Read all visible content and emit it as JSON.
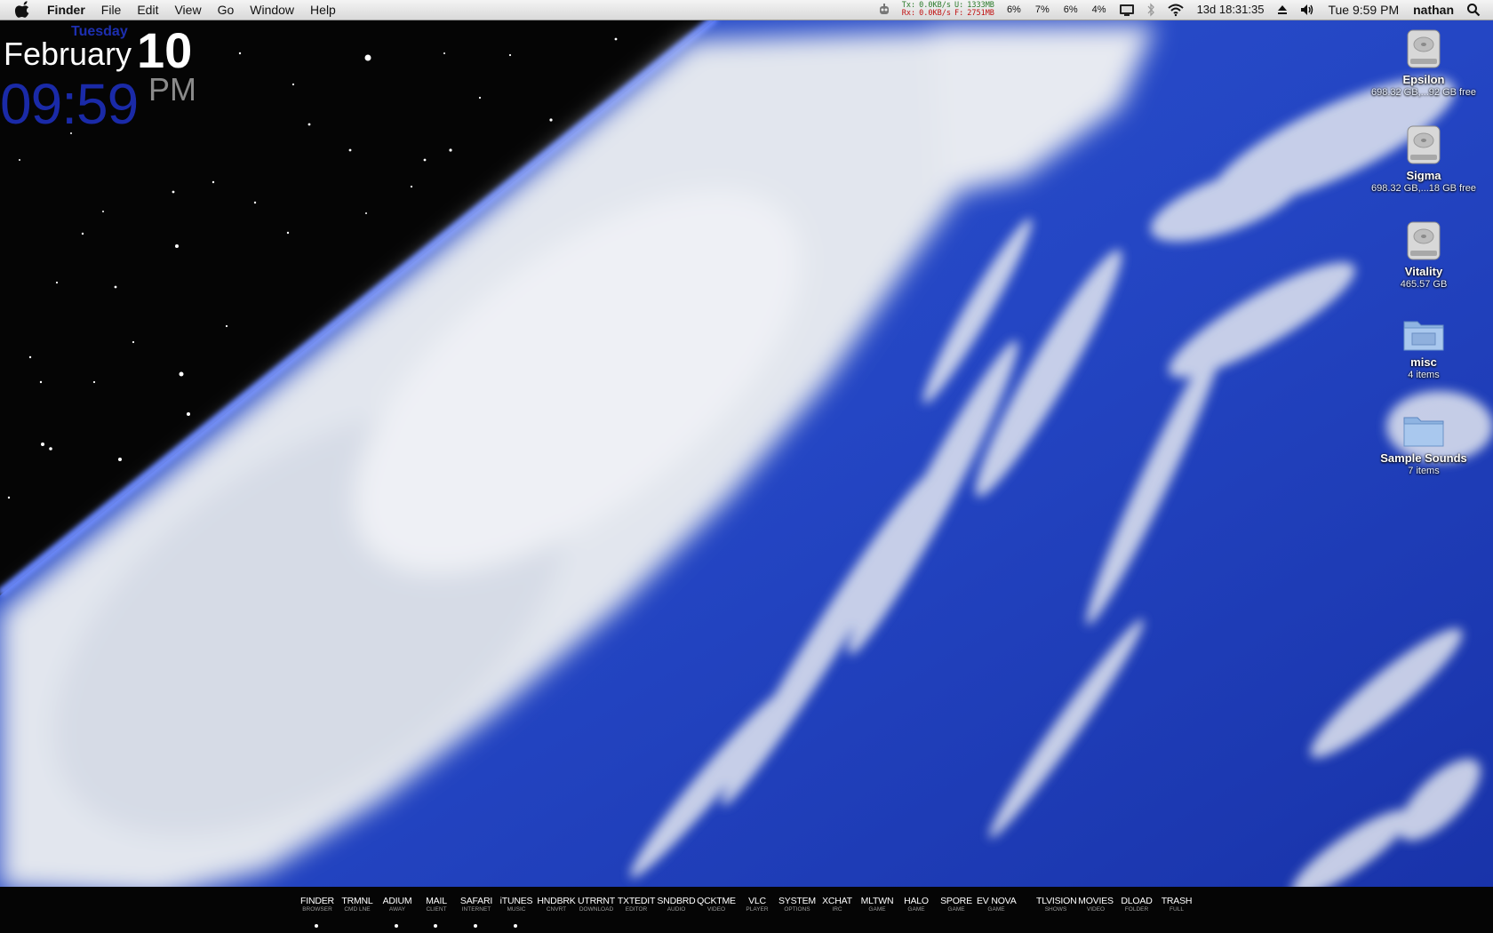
{
  "menubar": {
    "app_name": "Finder",
    "menus": [
      "File",
      "Edit",
      "View",
      "Go",
      "Window",
      "Help"
    ],
    "net": {
      "tx_label": "Tx:",
      "tx_value": "0.0KB/s",
      "rx_label": "Rx:",
      "rx_value": "0.0KB/s",
      "mem_u_label": "U:",
      "mem_u_value": "1333MB",
      "mem_f_label": "F:",
      "mem_f_value": "2751MB"
    },
    "cpu": [
      "6%",
      "7%",
      "6%",
      "4%"
    ],
    "uptime": "13d 18:31:35",
    "clock": "Tue 9:59 PM",
    "user": "nathan"
  },
  "clock_widget": {
    "day": "Tuesday",
    "month": "February",
    "date": "10",
    "time": "09:59",
    "ampm": "PM"
  },
  "desktop_icons": [
    {
      "name": "Epsilon",
      "sub": "698.32 GB,...92 GB free",
      "icon": "hard-drive"
    },
    {
      "name": "Sigma",
      "sub": "698.32 GB,...18 GB free",
      "icon": "hard-drive"
    },
    {
      "name": "Vitality",
      "sub": "465.57 GB",
      "icon": "hard-drive"
    },
    {
      "name": "misc",
      "sub": "4 items",
      "icon": "folder"
    },
    {
      "name": "Sample Sounds",
      "sub": "7 items",
      "icon": "folder"
    }
  ],
  "dock": [
    {
      "title": "FINDER",
      "sub": "BROWSER",
      "running": true
    },
    {
      "title": "TRMNL",
      "sub": "CMD LNE",
      "running": false
    },
    {
      "title": "ADIUM",
      "sub": "AWAY",
      "running": true
    },
    {
      "title": "MAIL",
      "sub": "CLIENT",
      "running": true
    },
    {
      "title": "SAFARI",
      "sub": "INTERNET",
      "running": true
    },
    {
      "title": "iTUNES",
      "sub": "MUSIC",
      "running": true
    },
    {
      "title": "HNDBRK",
      "sub": "CNVRT",
      "running": false
    },
    {
      "title": "UTRRNT",
      "sub": "DOWNLOAD",
      "running": false
    },
    {
      "title": "TXTEDIT",
      "sub": "EDITOR",
      "running": false
    },
    {
      "title": "SNDBRD",
      "sub": "AUDIO",
      "running": false
    },
    {
      "title": "QCKTME",
      "sub": "VIDEO",
      "running": false
    },
    {
      "title": "VLC",
      "sub": "PLAYER",
      "running": false
    },
    {
      "title": "SYSTEM",
      "sub": "OPTIONS",
      "running": false
    },
    {
      "title": "XCHAT",
      "sub": "IRC",
      "running": false
    },
    {
      "title": "MLTWN",
      "sub": "GAME",
      "running": false
    },
    {
      "title": "HALO",
      "sub": "GAME",
      "running": false
    },
    {
      "title": "SPORE",
      "sub": "GAME",
      "running": false
    },
    {
      "title": "EV NOVA",
      "sub": "GAME",
      "running": false
    },
    {
      "title": "TLVISION",
      "sub": "SHOWS",
      "running": false
    },
    {
      "title": "MOVIES",
      "sub": "VIDEO",
      "running": false
    },
    {
      "title": "DLOAD",
      "sub": "FOLDER",
      "running": false
    },
    {
      "title": "TRASH",
      "sub": "FULL",
      "running": false
    }
  ],
  "colors": {
    "space": "#050505",
    "ocean": "#1f3fb8",
    "clouds": "#e6eaf2",
    "clock_blue": "#1a2aa8"
  }
}
